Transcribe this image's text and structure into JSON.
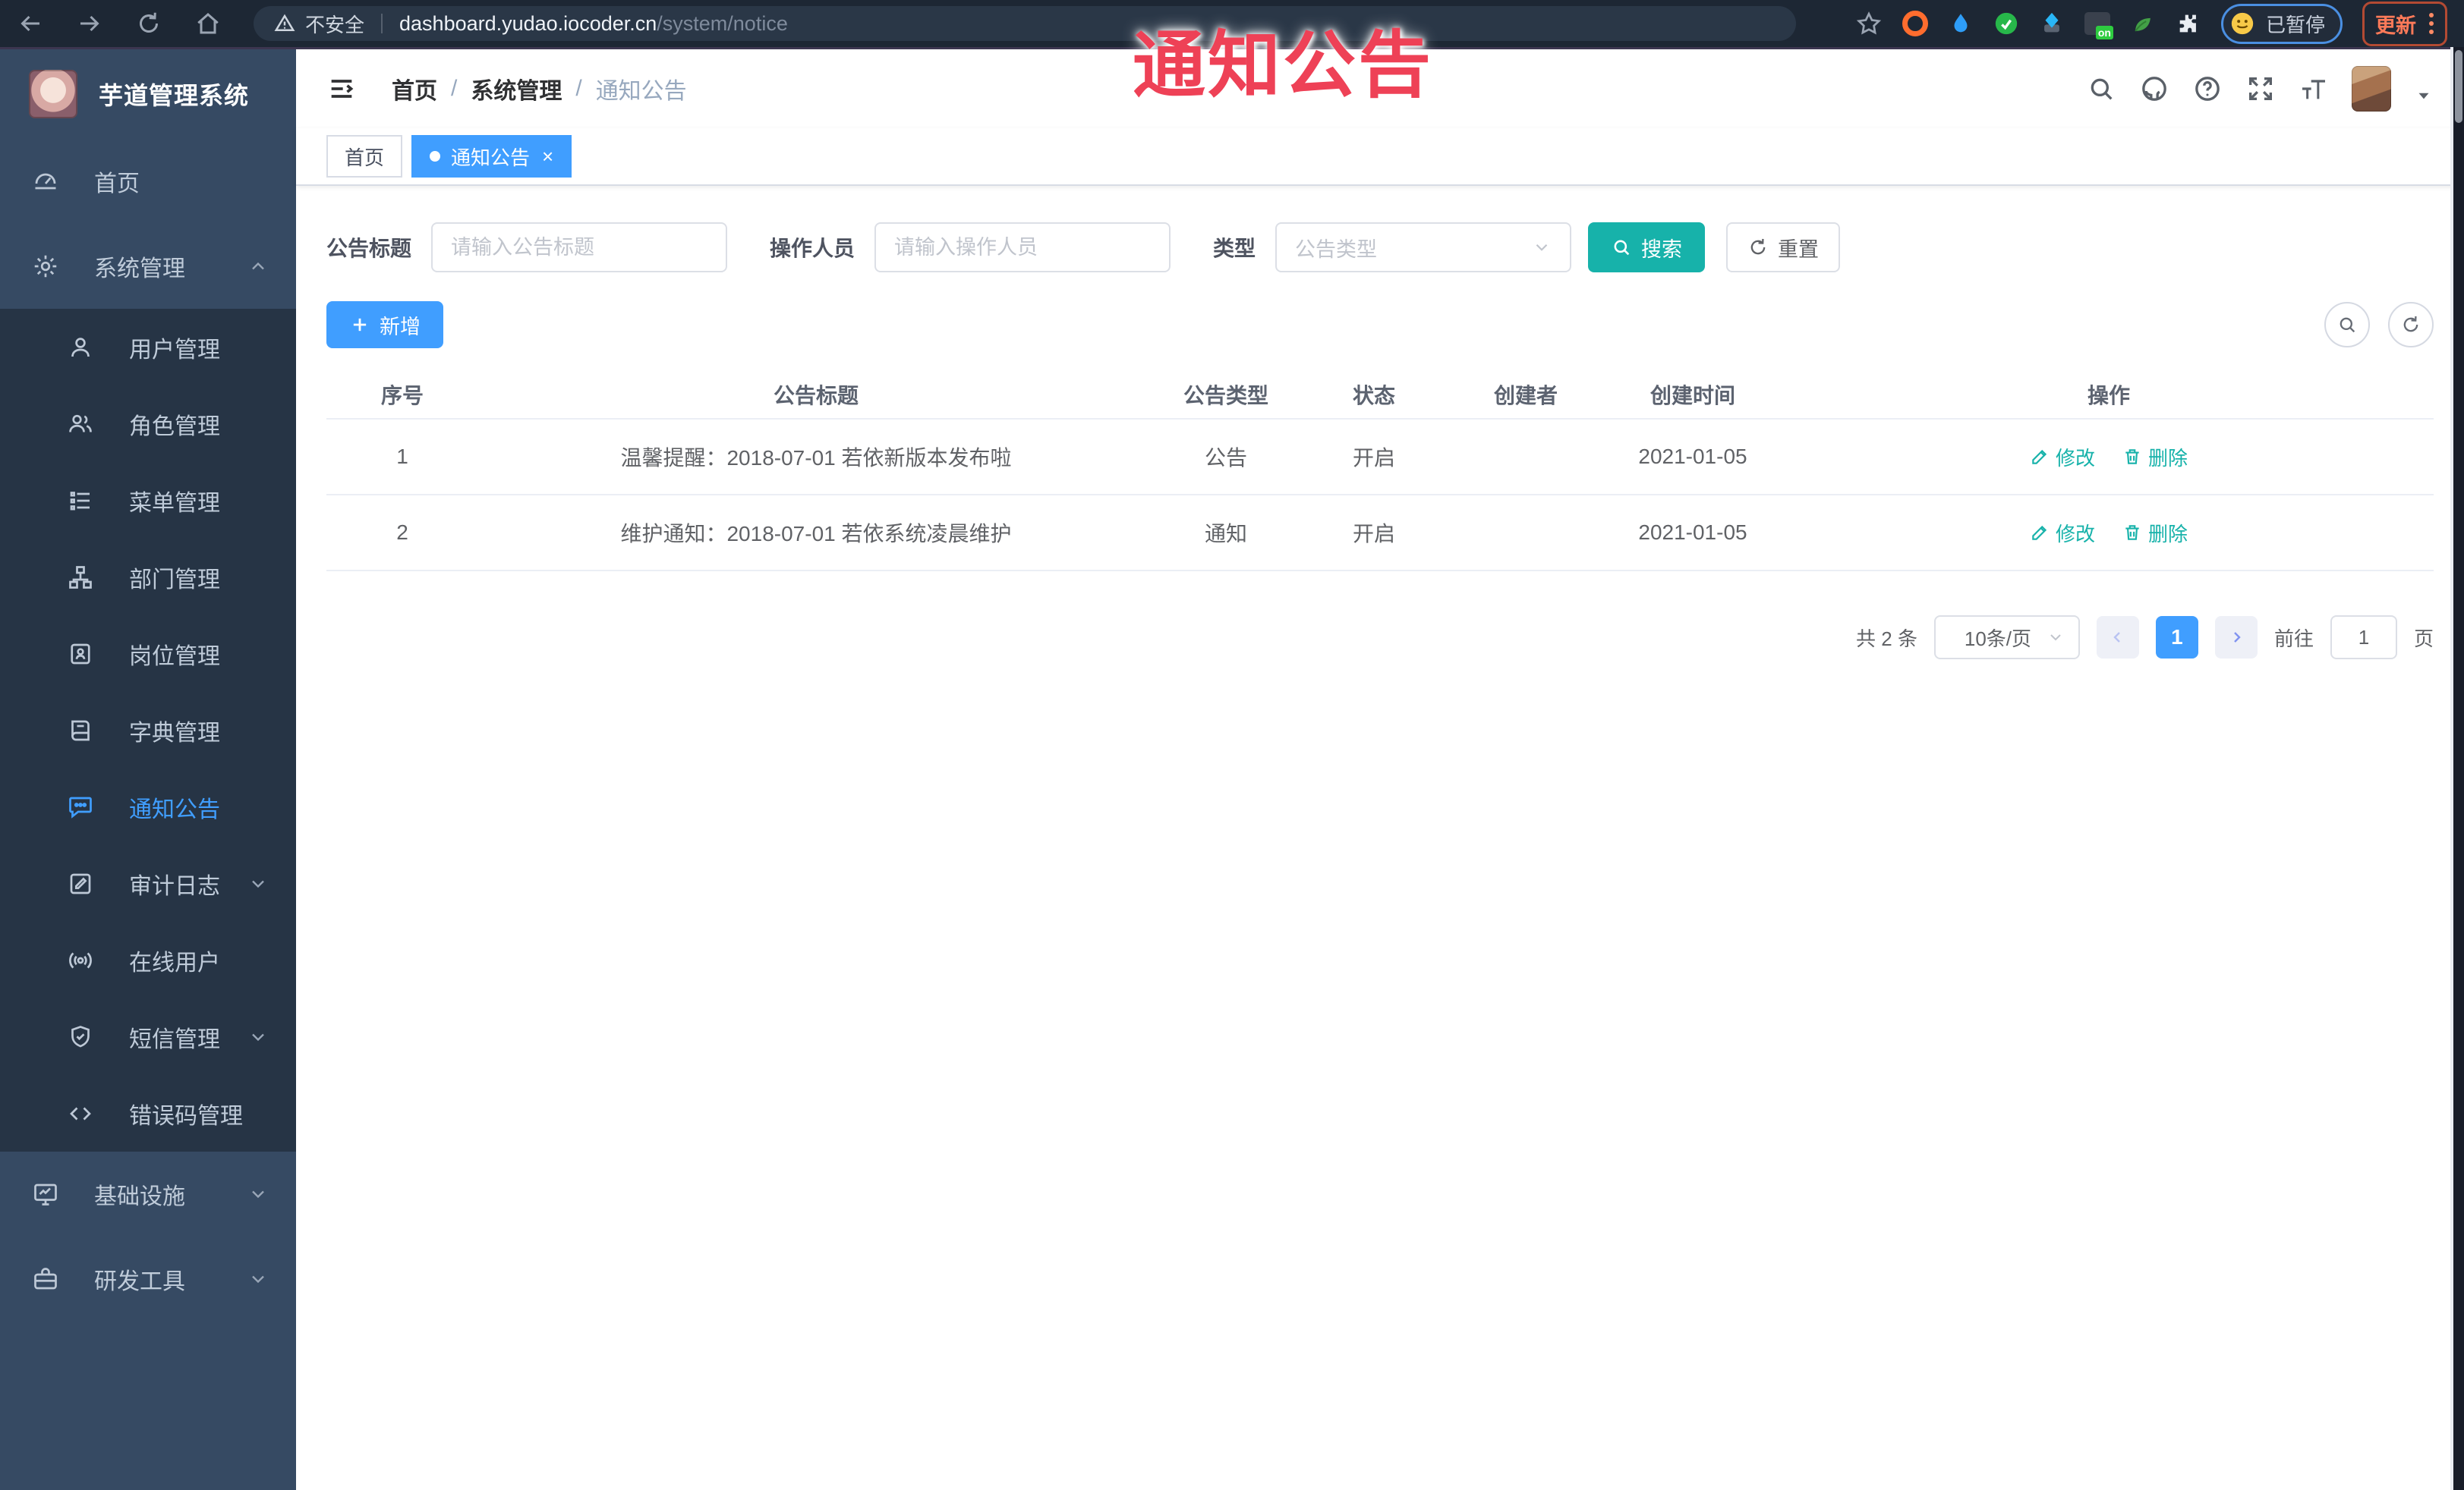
{
  "browser": {
    "security_label": "不安全",
    "url_host": "dashboard.yudao.iocoder.cn",
    "url_path": "/system/notice",
    "profile_status": "已暂停",
    "update_label": "更新",
    "extension_badge": "on"
  },
  "overlay": {
    "title": "通知公告",
    "color": "#EE4156"
  },
  "sidebar": {
    "logo_title": "芋道管理系统",
    "items": [
      {
        "label": "首页"
      },
      {
        "label": "系统管理"
      },
      {
        "label": "用户管理"
      },
      {
        "label": "角色管理"
      },
      {
        "label": "菜单管理"
      },
      {
        "label": "部门管理"
      },
      {
        "label": "岗位管理"
      },
      {
        "label": "字典管理"
      },
      {
        "label": "通知公告"
      },
      {
        "label": "审计日志"
      },
      {
        "label": "在线用户"
      },
      {
        "label": "短信管理"
      },
      {
        "label": "错误码管理"
      },
      {
        "label": "基础设施"
      },
      {
        "label": "研发工具"
      }
    ]
  },
  "header": {
    "breadcrumb": {
      "home": "首页",
      "section": "系统管理",
      "current": "通知公告"
    }
  },
  "tags": {
    "home": "首页",
    "current": "通知公告"
  },
  "search": {
    "title_label": "公告标题",
    "title_placeholder": "请输入公告标题",
    "operator_label": "操作人员",
    "operator_placeholder": "请输入操作人员",
    "type_label": "类型",
    "type_placeholder": "公告类型",
    "search_button": "搜索",
    "reset_button": "重置"
  },
  "toolbar": {
    "add_button": "新增"
  },
  "table": {
    "columns": [
      "序号",
      "公告标题",
      "公告类型",
      "状态",
      "创建者",
      "创建时间",
      "操作"
    ],
    "rows": [
      {
        "no": "1",
        "title": "温馨提醒：2018-07-01 若依新版本发布啦",
        "type": "公告",
        "status": "开启",
        "creator": "",
        "create_time": "2021-01-05"
      },
      {
        "no": "2",
        "title": "维护通知：2018-07-01 若依系统凌晨维护",
        "type": "通知",
        "status": "开启",
        "creator": "",
        "create_time": "2021-01-05"
      }
    ],
    "actions": {
      "edit": "修改",
      "delete": "删除"
    }
  },
  "pagination": {
    "total_text": "共 2 条",
    "page_size": "10条/页",
    "current_page": "1",
    "goto_label": "前往",
    "goto_value": "1",
    "page_unit": "页"
  },
  "colors": {
    "primary": "#409EFF",
    "theme_teal": "#17B2AA",
    "sidebar_bg": "#364A63",
    "submenu_bg": "#263445",
    "overlay_red": "#EE4156"
  }
}
